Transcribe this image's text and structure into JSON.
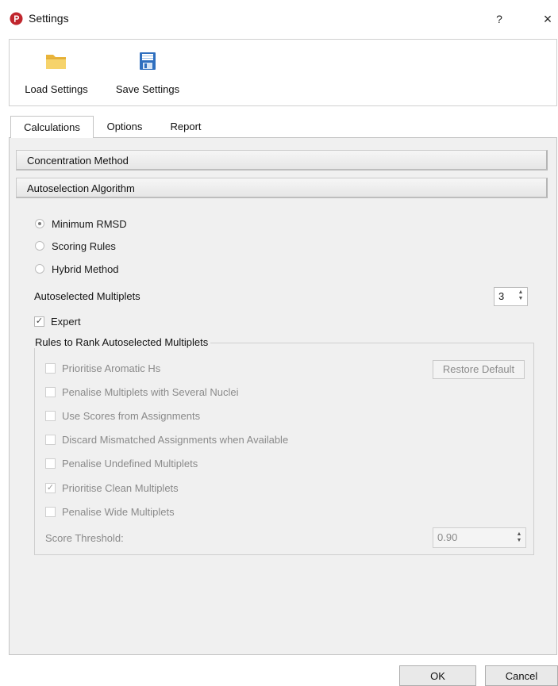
{
  "window": {
    "title": "Settings",
    "help_label": "?",
    "close_label": "×"
  },
  "toolbar": {
    "load_label": "Load Settings",
    "save_label": "Save Settings"
  },
  "tabs": [
    {
      "label": "Calculations",
      "active": true
    },
    {
      "label": "Options",
      "active": false
    },
    {
      "label": "Report",
      "active": false
    }
  ],
  "sections": {
    "concentration": "Concentration Method",
    "autoselection": "Autoselection Algorithm"
  },
  "algorithm": {
    "options": [
      {
        "label": "Minimum RMSD",
        "selected": true
      },
      {
        "label": "Scoring Rules",
        "selected": false
      },
      {
        "label": "Hybrid Method",
        "selected": false
      }
    ],
    "multiplets_label": "Autoselected Multiplets",
    "multiplets_value": "3",
    "expert_label": "Expert",
    "expert_checked": true
  },
  "rules": {
    "title": "Rules to Rank Autoselected Multiplets",
    "restore_label": "Restore Default",
    "items": [
      {
        "label": "Prioritise Aromatic Hs",
        "checked": false
      },
      {
        "label": "Penalise Multiplets with Several Nuclei",
        "checked": false
      },
      {
        "label": "Use Scores from Assignments",
        "checked": false
      },
      {
        "label": "Discard Mismatched Assignments when Available",
        "checked": false
      },
      {
        "label": "Penalise Undefined Multiplets",
        "checked": false
      },
      {
        "label": "Prioritise Clean Multiplets",
        "checked": true
      },
      {
        "label": "Penalise Wide Multiplets",
        "checked": false
      }
    ],
    "threshold_label": "Score Threshold:",
    "threshold_value": "0.90"
  },
  "footer": {
    "ok_label": "OK",
    "cancel_label": "Cancel"
  },
  "colors": {
    "brand_icon": "#c0262d",
    "folder": "#f2c94c",
    "floppy": "#2f6fbf"
  },
  "icons": [
    "app-logo-icon",
    "folder-icon",
    "floppy-disk-icon"
  ]
}
